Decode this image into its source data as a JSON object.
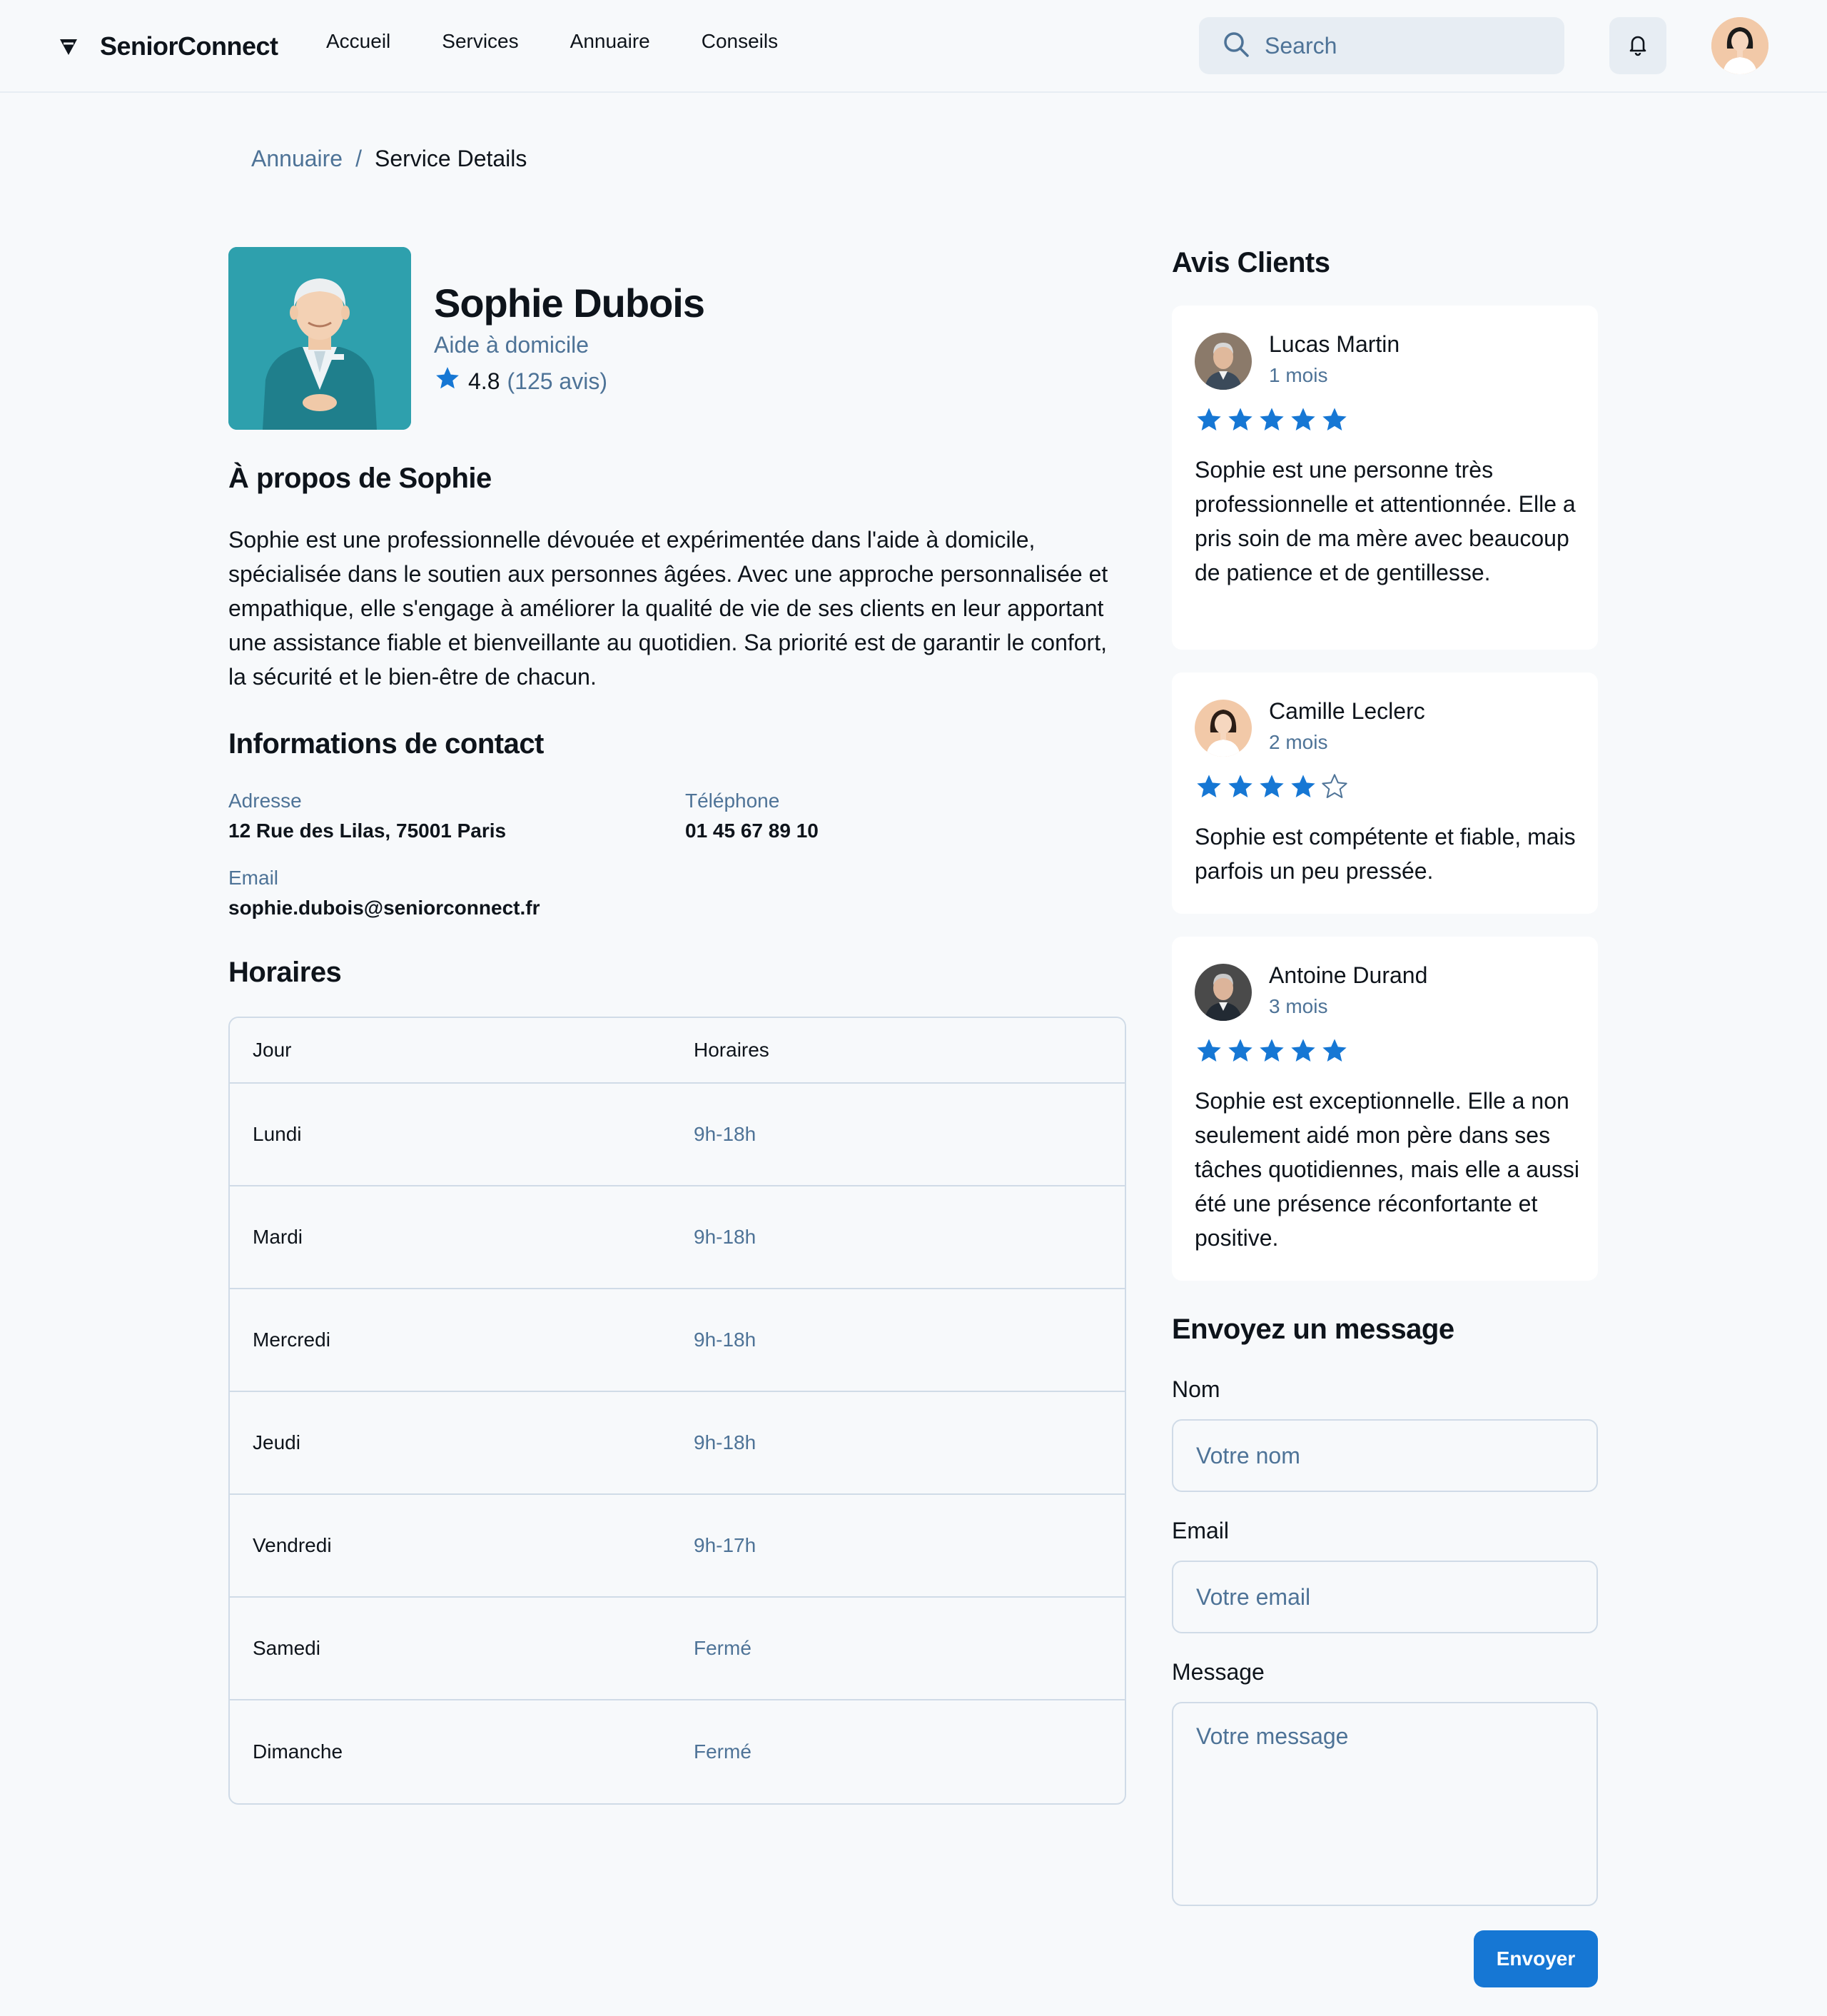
{
  "header": {
    "brand": "SeniorConnect",
    "nav": [
      "Accueil",
      "Services",
      "Annuaire",
      "Conseils"
    ],
    "search_placeholder": "Search"
  },
  "breadcrumb": {
    "parent": "Annuaire",
    "separator": "/",
    "current": "Service Details"
  },
  "profile": {
    "name": "Sophie Dubois",
    "role": "Aide à domicile",
    "rating": "4.8",
    "reviews_count": "(125 avis)"
  },
  "about": {
    "title": "À propos de Sophie",
    "text": "Sophie est une professionnelle dévouée et expérimentée dans l'aide à domicile, spécialisée dans le soutien aux personnes âgées. Avec une approche personnalisée et empathique, elle s'engage à améliorer la qualité de vie de ses clients en leur apportant une assistance fiable et bienveillante au quotidien. Sa priorité est de garantir le confort, la sécurité et le bien-être de chacun."
  },
  "contact": {
    "title": "Informations de contact",
    "address_label": "Adresse",
    "address": "12 Rue des Lilas, 75001 Paris",
    "phone_label": "Téléphone",
    "phone": "01 45 67 89 10",
    "email_label": "Email",
    "email": "sophie.dubois@seniorconnect.fr"
  },
  "hours": {
    "title": "Horaires",
    "col_day": "Jour",
    "col_hours": "Horaires",
    "rows": [
      {
        "day": "Lundi",
        "hours": "9h-18h"
      },
      {
        "day": "Mardi",
        "hours": "9h-18h"
      },
      {
        "day": "Mercredi",
        "hours": "9h-18h"
      },
      {
        "day": "Jeudi",
        "hours": "9h-18h"
      },
      {
        "day": "Vendredi",
        "hours": "9h-17h"
      },
      {
        "day": "Samedi",
        "hours": "Fermé"
      },
      {
        "day": "Dimanche",
        "hours": "Fermé"
      }
    ]
  },
  "reviews": {
    "title": "Avis Clients",
    "items": [
      {
        "name": "Lucas Martin",
        "date": "1 mois",
        "stars": 5,
        "text": "Sophie est une personne très professionnelle et attentionnée. Elle a pris soin de ma mère avec beaucoup de patience et de gentillesse."
      },
      {
        "name": "Camille Leclerc",
        "date": "2 mois",
        "stars": 4,
        "text": "Sophie est compétente et fiable, mais parfois un peu pressée."
      },
      {
        "name": "Antoine Durand",
        "date": "3 mois",
        "stars": 5,
        "text": "Sophie est exceptionnelle. Elle a non seulement aidé mon père dans ses tâches quotidiennes, mais elle a aussi été une présence réconfortante et positive."
      }
    ]
  },
  "message_form": {
    "title": "Envoyez un message",
    "name_label": "Nom",
    "name_placeholder": "Votre nom",
    "email_label": "Email",
    "email_placeholder": "Votre email",
    "message_label": "Message",
    "message_placeholder": "Votre message",
    "submit": "Envoyer"
  },
  "colors": {
    "accent": "#1677d4",
    "muted_text": "#4e7397",
    "border": "#d0dbe7",
    "background": "#f7f9fb"
  }
}
